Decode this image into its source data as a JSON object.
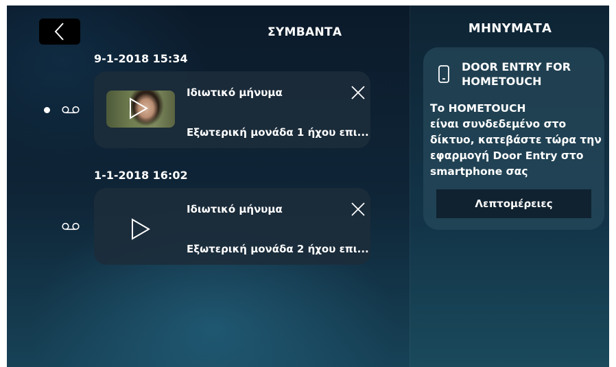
{
  "header": {
    "title": "ΣΥΜΒΑΝΤΑ",
    "back_icon": "chevron-left-icon"
  },
  "events": [
    {
      "date": "9-1-2018  15:34",
      "title": "Ιδιωτικό μήνυμα",
      "subtitle": "Εξωτερική μονάδα 1 ήχου επι...",
      "unread": true,
      "has_thumbnail": true
    },
    {
      "date": "1-1-2018  16:02",
      "title": "Ιδιωτικό μήνυμα",
      "subtitle": "Εξωτερική μονάδα 2 ήχου επι...",
      "unread": false,
      "has_thumbnail": false
    }
  ],
  "messages_panel": {
    "title": "ΜΗΝΥΜΑΤΑ",
    "card_title_line1": "DOOR ENTRY FOR",
    "card_title_line2": "HOMETOUCH",
    "card_text_line1": "Το HOMETOUCH",
    "card_text_line2": "είναι συνδεδεμένο στο",
    "card_text_line3": "δίκτυο, κατεβάστε τώρα την",
    "card_text_line4": "εφαρμογή Door Entry στο",
    "card_text_line5": "smartphone σας",
    "details_button": "Λεπτομέρειες",
    "card_icon": "smartphone-icon"
  }
}
